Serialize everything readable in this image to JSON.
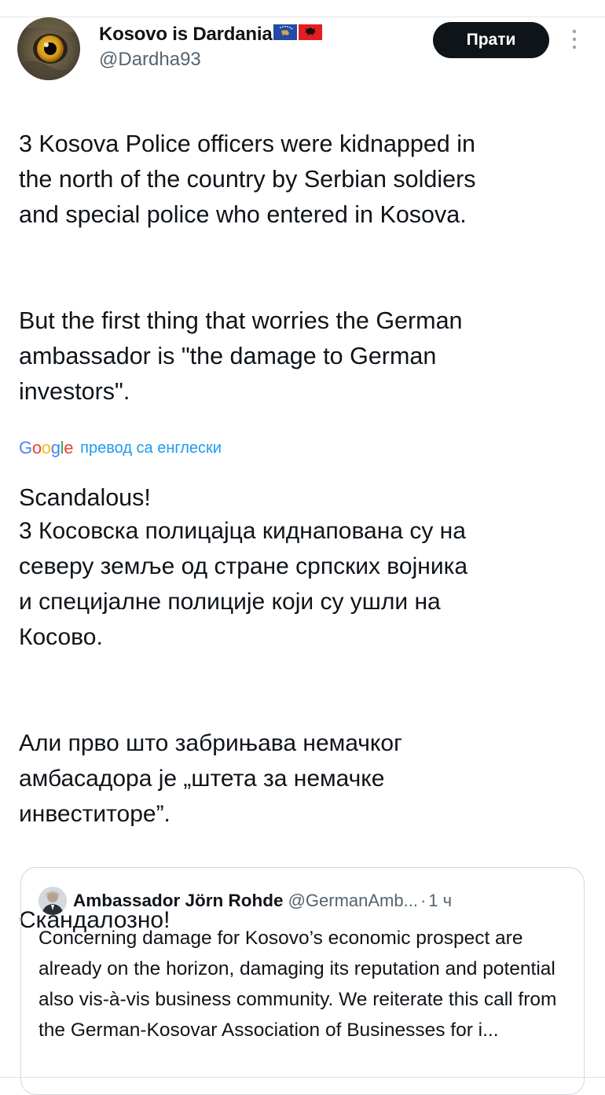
{
  "author": {
    "display_name": "Kosovo is Dardania",
    "flags": [
      "kosovo-flag-icon",
      "albania-flag-icon"
    ],
    "handle": "@Dardha93",
    "avatar": "eagle-eye-avatar"
  },
  "follow_label": "Прати",
  "more_icon": "more-vertical-icon",
  "tweet": {
    "paragraphs": [
      "3 Kosova Police officers were kidnapped in\nthe north of the country by Serbian soldiers\nand special police who entered in Kosova.",
      "But the first thing that worries the German\nambassador is \"the damage to German\ninvestors\".",
      "Scandalous!"
    ]
  },
  "translation": {
    "provider": "Google",
    "label": "превод са енглески",
    "paragraphs": [
      "3 Косовска полицајца киднапована су на\nсеверу земље од стране српских војника\nи специјалне полиције који су ушли на\nКосово.",
      "Али прво што забрињава немачког\nамбасадора је „штета за немачке\nинвеститоре”.",
      "Скандалозно!"
    ]
  },
  "quote": {
    "name": "Ambassador Jörn Rohde",
    "handle": "@GermanAmb...",
    "separator": "·",
    "time": "1 ч",
    "text": "Concerning damage for Kosovo’s economic prospect are already on the horizon, damaging its reputation and potential also vis-à-vis business community. We reiterate this call from the German-Kosovar Association of Businesses for i..."
  },
  "colors": {
    "text": "#0f1419",
    "secondary": "#536471",
    "accent": "#1d9bf0",
    "follow_bg": "#0f1419"
  }
}
